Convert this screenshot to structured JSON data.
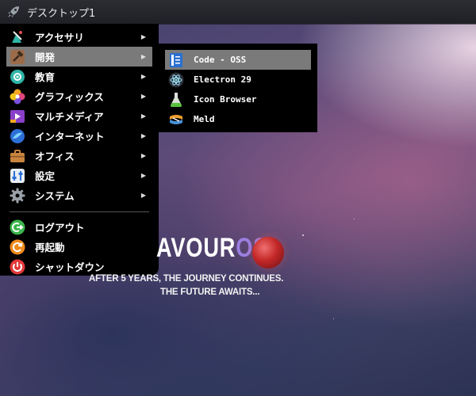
{
  "topbar": {
    "title": "デスクトップ1",
    "icon": "rocket-icon"
  },
  "menu": {
    "items": [
      {
        "label": "アクセサリ",
        "icon": "accessories-icon",
        "arrow": "▶"
      },
      {
        "label": "開発",
        "icon": "development-icon",
        "arrow": "▶"
      },
      {
        "label": "教育",
        "icon": "education-icon",
        "arrow": "▶"
      },
      {
        "label": "グラフィックス",
        "icon": "graphics-icon",
        "arrow": "▶"
      },
      {
        "label": "マルチメディア",
        "icon": "multimedia-icon",
        "arrow": "▶"
      },
      {
        "label": "インターネット",
        "icon": "internet-icon",
        "arrow": "▶"
      },
      {
        "label": "オフィス",
        "icon": "office-icon",
        "arrow": "▶"
      },
      {
        "label": "設定",
        "icon": "settings-icon",
        "arrow": "▶"
      },
      {
        "label": "システム",
        "icon": "system-icon",
        "arrow": "▶"
      }
    ],
    "session": [
      {
        "label": "ログアウト",
        "icon": "logout-icon"
      },
      {
        "label": "再起動",
        "icon": "reboot-icon"
      },
      {
        "label": "シャットダウン",
        "icon": "shutdown-icon"
      }
    ]
  },
  "submenu": {
    "items": [
      {
        "label": "Code - OSS",
        "icon": "code-oss-icon"
      },
      {
        "label": "Electron 29",
        "icon": "electron-icon"
      },
      {
        "label": "Icon Browser",
        "icon": "icon-browser-icon"
      },
      {
        "label": "Meld",
        "icon": "meld-icon"
      }
    ]
  },
  "wallpaper": {
    "brand_main": "AVOUR",
    "brand_highlight": "OS",
    "tagline1": "AFTER 5 YEARS, THE JOURNEY CONTINUES.",
    "tagline2": "THE FUTURE AWAITS..."
  },
  "colors": {
    "accent": "#9b7fe0",
    "highlight": "#7a7a7a",
    "menu_bg": "#000000"
  }
}
